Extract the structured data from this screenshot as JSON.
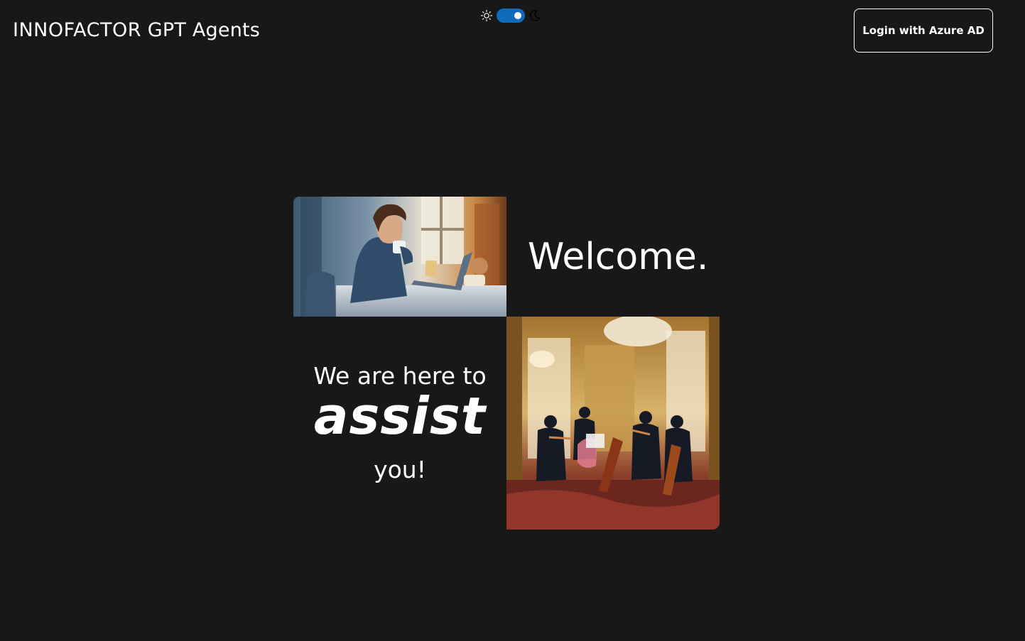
{
  "header": {
    "brand_logo": "INNOFACTOR",
    "brand_suffix": " GPT Agents",
    "login_label": "Login with Azure AD"
  },
  "theme_toggle": {
    "light_icon": "sun-icon",
    "dark_icon": "moon-icon",
    "state": "dark",
    "accent": "#0f6cbd"
  },
  "hero": {
    "welcome": "Welcome.",
    "line1": "We are here to",
    "line2": "assist",
    "line3": "you!",
    "image_top": "painting-woman-with-laptop",
    "image_bottom": "painting-string-quartet"
  },
  "colors": {
    "background": "#181818",
    "text": "#ffffff"
  }
}
